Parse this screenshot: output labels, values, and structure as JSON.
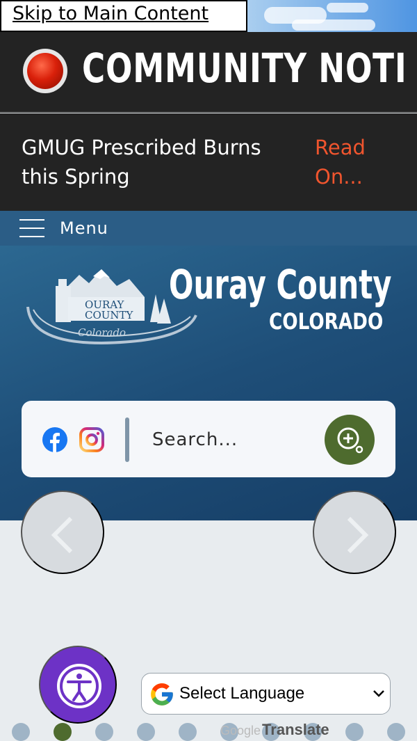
{
  "skip_link": "Skip to Main Content",
  "notice": {
    "title": "COMMUNITY NOTI"
  },
  "alert": {
    "text": "GMUG Prescribed Burns this Spring",
    "read_more": "Read On..."
  },
  "menu": {
    "label": "Menu"
  },
  "site": {
    "title": "Ouray County",
    "state": "COLORADO",
    "logo_text": {
      "line1": "OURAY",
      "line2": "COUNTY",
      "script": "Colorado"
    }
  },
  "search": {
    "placeholder": "Search..."
  },
  "social": [
    "facebook-icon",
    "instagram-icon"
  ],
  "translate": {
    "select_label": "Select Language",
    "powered_google": "Google",
    "powered_translate": "Translate"
  },
  "colors": {
    "accent_green": "#4e6b2e",
    "notice_red": "#f0552e",
    "hero_blue": "#1e4e78",
    "access_purple": "#6d32c6"
  },
  "carousel": {
    "dot_count": 10,
    "active_index": 1
  }
}
